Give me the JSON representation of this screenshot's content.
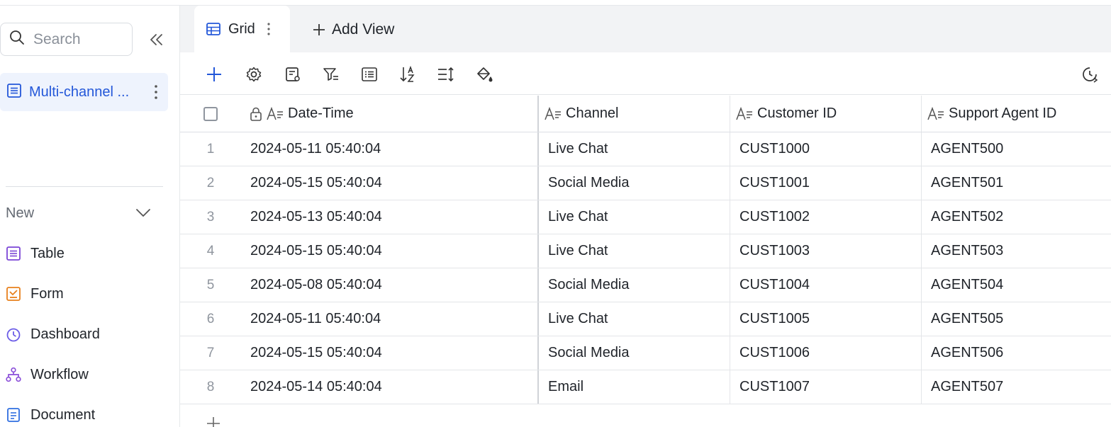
{
  "sidebar": {
    "search_placeholder": "Search",
    "active_table": "Multi-channel ...",
    "new_label": "New",
    "menu": [
      {
        "label": "Table",
        "icon": "table-icon"
      },
      {
        "label": "Form",
        "icon": "form-icon"
      },
      {
        "label": "Dashboard",
        "icon": "dashboard-icon"
      },
      {
        "label": "Workflow",
        "icon": "workflow-icon"
      },
      {
        "label": "Document",
        "icon": "document-icon"
      }
    ]
  },
  "tabs": {
    "grid_label": "Grid",
    "add_view_label": "Add View"
  },
  "toolbar": {
    "icons": [
      "add-record-icon",
      "settings-icon",
      "fields-icon",
      "filter-icon",
      "group-icon",
      "sort-icon",
      "row-height-icon",
      "fill-color-icon",
      "history-icon"
    ]
  },
  "grid": {
    "columns": [
      "Date-Time",
      "Channel",
      "Customer ID",
      "Support Agent ID"
    ],
    "rows": [
      {
        "num": "1",
        "datetime": "2024-05-11 05:40:04",
        "channel": "Live Chat",
        "customer": "CUST1000",
        "agent": "AGENT500"
      },
      {
        "num": "2",
        "datetime": "2024-05-15 05:40:04",
        "channel": "Social Media",
        "customer": "CUST1001",
        "agent": "AGENT501"
      },
      {
        "num": "3",
        "datetime": "2024-05-13 05:40:04",
        "channel": "Live Chat",
        "customer": "CUST1002",
        "agent": "AGENT502"
      },
      {
        "num": "4",
        "datetime": "2024-05-15 05:40:04",
        "channel": "Live Chat",
        "customer": "CUST1003",
        "agent": "AGENT503"
      },
      {
        "num": "5",
        "datetime": "2024-05-08 05:40:04",
        "channel": "Social Media",
        "customer": "CUST1004",
        "agent": "AGENT504"
      },
      {
        "num": "6",
        "datetime": "2024-05-11 05:40:04",
        "channel": "Live Chat",
        "customer": "CUST1005",
        "agent": "AGENT505"
      },
      {
        "num": "7",
        "datetime": "2024-05-15 05:40:04",
        "channel": "Social Media",
        "customer": "CUST1006",
        "agent": "AGENT506"
      },
      {
        "num": "8",
        "datetime": "2024-05-14 05:40:04",
        "channel": "Email",
        "customer": "CUST1007",
        "agent": "AGENT507"
      }
    ]
  },
  "colors": {
    "accent": "#2357d9",
    "active_bg": "#eef3fd",
    "tabbar_bg": "#f2f3f5",
    "table_icon": "#7b45d6",
    "form_icon": "#e8801c",
    "dashboard_icon": "#6b5ce7",
    "workflow_icon": "#8b4fd9",
    "document_icon": "#2f6ee0"
  }
}
